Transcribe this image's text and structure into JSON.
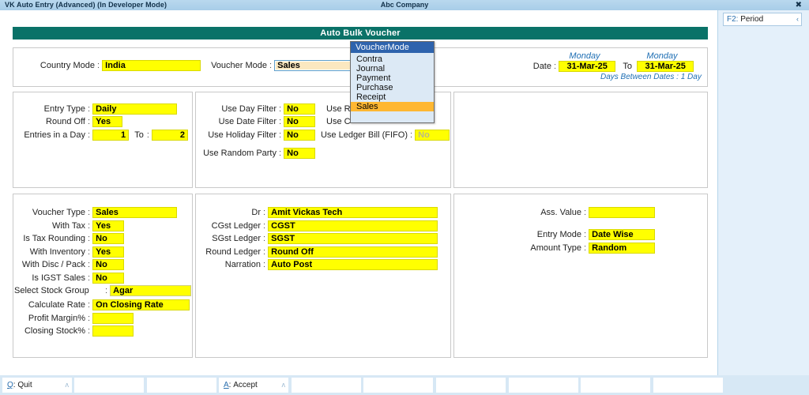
{
  "titlebar": {
    "app_title": "VK Auto Entry (Advanced) (In Developer Mode)",
    "company": "Abc Company",
    "close_glyph": "✖"
  },
  "right_pane": {
    "period_button": {
      "key": "F2",
      "sep": ":",
      "label": "Period",
      "chevron": "‹"
    }
  },
  "page": {
    "heading": "Auto Bulk Voucher"
  },
  "top_panel": {
    "country_mode": {
      "label": "Country Mode",
      "value": "India"
    },
    "voucher_mode": {
      "label": "Voucher Mode",
      "value": "Sales"
    },
    "date": {
      "label": "Date",
      "from_dow": "Monday",
      "from_value": "31-Mar-25",
      "to_word": "To",
      "to_dow": "Monday",
      "to_value": "31-Mar-25",
      "days_between": "Days Between Dates : 1 Day"
    }
  },
  "dropdown": {
    "title": "VoucherMode",
    "items": [
      "Contra",
      "Journal",
      "Payment",
      "Purchase",
      "Receipt",
      "Sales"
    ],
    "selected": "Sales"
  },
  "mid_left": {
    "entry_type": {
      "label": "Entry Type",
      "value": "Daily"
    },
    "round_off": {
      "label": "Round Off",
      "value": "Yes"
    },
    "entries_in_day": {
      "label": "Entries in a Day",
      "value": "1",
      "to_word": "To",
      "to_label": "To",
      "to_value": "2"
    }
  },
  "mid_center": {
    "use_day_filter": {
      "label": "Use Day Filter",
      "value": "No"
    },
    "use_date_filter": {
      "label": "Use Date Filter",
      "value": "No"
    },
    "use_holiday_filter": {
      "label": "Use Holiday Filter",
      "value": "No"
    },
    "use_random_party": {
      "label": "Use Random Party",
      "value": "No"
    },
    "occluded_label_1": "Use R",
    "occluded_label_2": "Use C",
    "use_ledger_bill": {
      "label": "Use Ledger Bill (FIFO)",
      "value": "No"
    }
  },
  "bottom_left": {
    "voucher_type": {
      "label": "Voucher Type",
      "value": "Sales"
    },
    "with_tax": {
      "label": "With Tax",
      "value": "Yes"
    },
    "is_tax_rounding": {
      "label": "Is Tax Rounding",
      "value": "No"
    },
    "with_inventory": {
      "label": "With Inventory",
      "value": "Yes"
    },
    "with_disc_pack": {
      "label": "With Disc / Pack",
      "value": "No"
    },
    "is_igst_sales": {
      "label": "Is IGST Sales",
      "value": "No"
    },
    "select_stock_group": {
      "label": "Select Stock Group",
      "value": "Agar"
    },
    "calculate_rate": {
      "label": "Calculate Rate",
      "value": "On Closing Rate"
    },
    "profit_margin": {
      "label": "Profit Margin%",
      "value": ""
    },
    "closing_stock": {
      "label": "Closing Stock%",
      "value": ""
    }
  },
  "bottom_center": {
    "dr": {
      "label": "Dr",
      "value": "Amit Vickas Tech"
    },
    "cgst_ledger": {
      "label": "CGst Ledger",
      "value": "CGST"
    },
    "sgst_ledger": {
      "label": "SGst Ledger",
      "value": "SGST"
    },
    "round_ledger": {
      "label": "Round Ledger",
      "value": "Round Off"
    },
    "narration": {
      "label": "Narration",
      "value": "Auto Post"
    }
  },
  "bottom_right": {
    "ass_value": {
      "label": "Ass. Value",
      "value": ""
    },
    "entry_mode": {
      "label": "Entry Mode",
      "value": "Date Wise"
    },
    "amount_type": {
      "label": "Amount Type",
      "value": "Random"
    }
  },
  "bottom_bar": {
    "buttons": [
      {
        "key": "Q",
        "sep": ":",
        "label": "Quit",
        "chevron": "ʌ"
      },
      {
        "key": "",
        "sep": "",
        "label": "",
        "chevron": ""
      },
      {
        "key": "",
        "sep": "",
        "label": "",
        "chevron": ""
      },
      {
        "key": "A",
        "sep": ":",
        "label": "Accept",
        "chevron": "ʌ"
      },
      {
        "key": "",
        "sep": "",
        "label": "",
        "chevron": ""
      },
      {
        "key": "",
        "sep": "",
        "label": "",
        "chevron": ""
      },
      {
        "key": "",
        "sep": "",
        "label": "",
        "chevron": ""
      },
      {
        "key": "",
        "sep": "",
        "label": "",
        "chevron": ""
      },
      {
        "key": "",
        "sep": "",
        "label": "",
        "chevron": ""
      },
      {
        "key": "",
        "sep": "",
        "label": "",
        "chevron": ""
      }
    ]
  },
  "colors": {
    "teal": "#0a7268",
    "field_yellow": "#ffff00",
    "dropdown_header": "#2e63ad",
    "dropdown_selected": "#ffb732",
    "titlebar_blue": "#a8cde8",
    "accent_blue": "#1f6fb4"
  }
}
